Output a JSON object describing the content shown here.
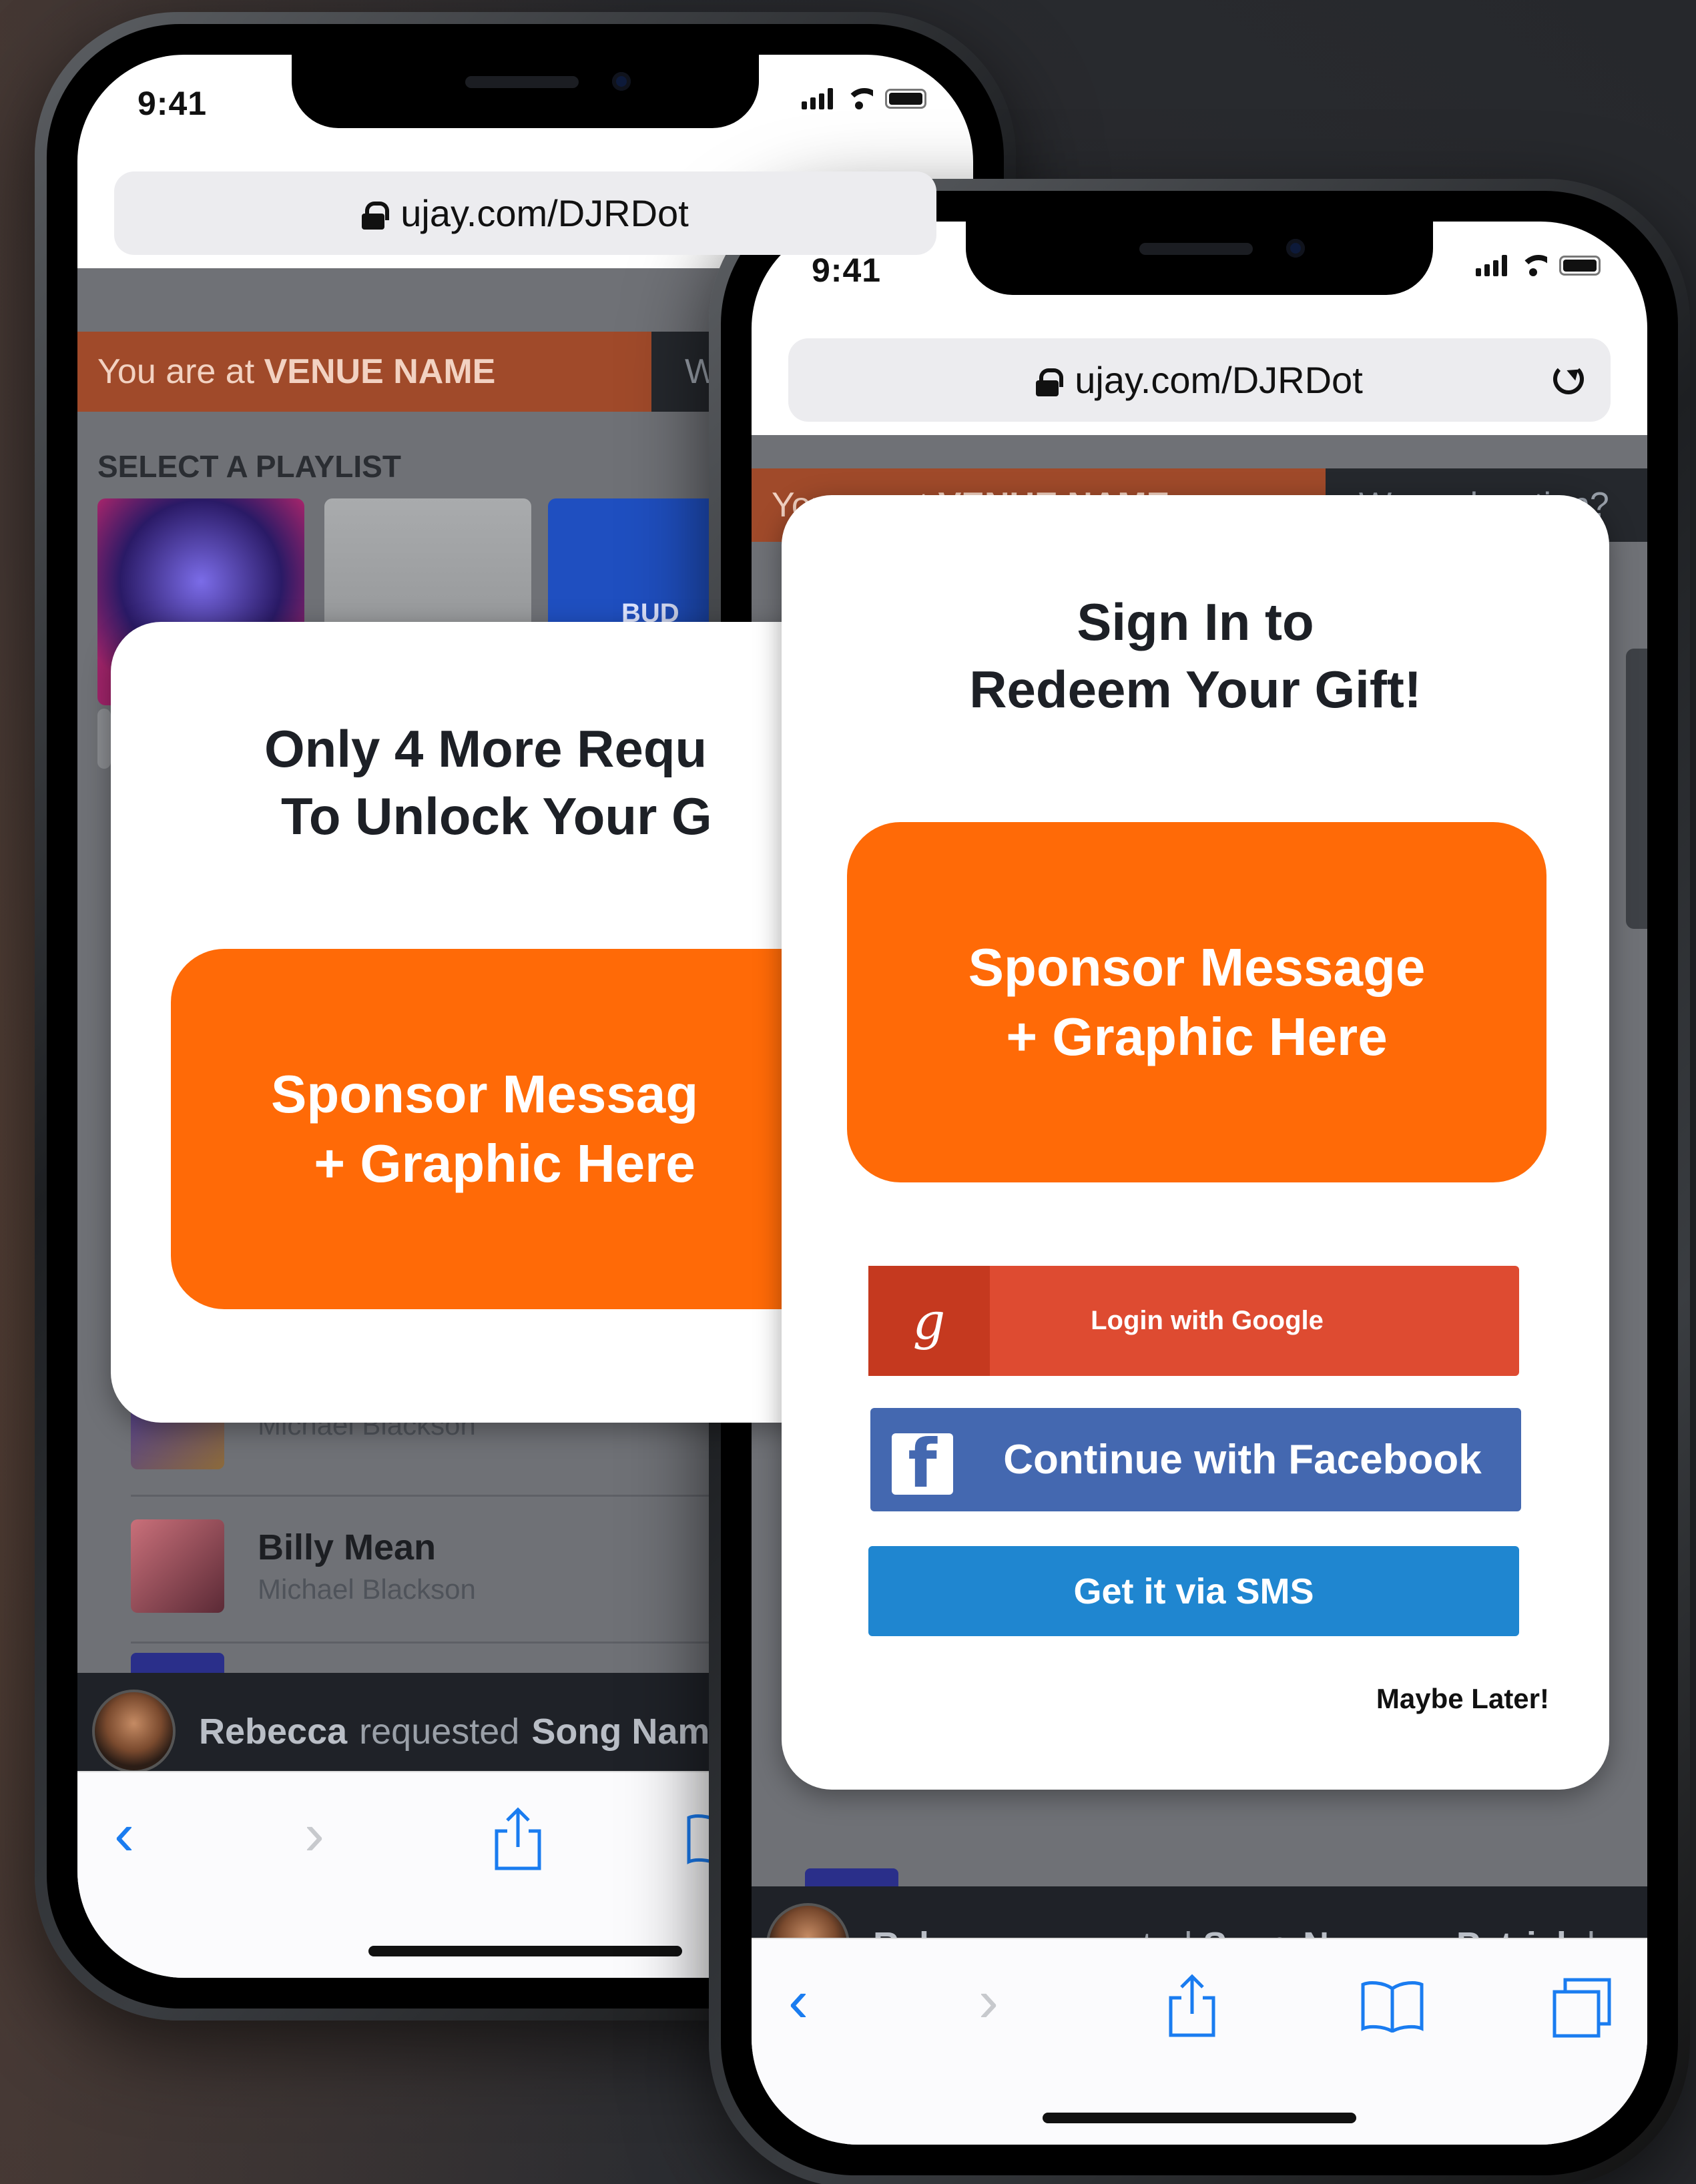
{
  "status": {
    "time": "9:41"
  },
  "browser": {
    "url": "ujay.com/DJRDot"
  },
  "venue": {
    "prefix": "You are at",
    "name": "VENUE NAME",
    "wrong_location": "Wrong location?"
  },
  "playlist": {
    "label": "SELECT A PLAYLIST",
    "bud_label": "BUD"
  },
  "songs": [
    {
      "title": "",
      "artist": "Michael Blackson"
    },
    {
      "title": "Billy Mean",
      "artist": "Michael Blackson"
    }
  ],
  "ticker": {
    "user1": "Rebecca",
    "verb1": "requested",
    "song1": "Song Name",
    "separator": "•",
    "user2": "Patrick",
    "verb2": "bou"
  },
  "left_modal": {
    "line1": "Only 4 More Requ",
    "line2": "To Unlock Your G",
    "sponsor_line1": "Sponsor Messag",
    "sponsor_line2": "+ Graphic Here"
  },
  "right_modal": {
    "line1": "Sign In to",
    "line2": "Redeem Your Gift!",
    "sponsor_line1": "Sponsor Message",
    "sponsor_line2": "+ Graphic Here",
    "google_label": "Login with Google",
    "facebook_label": "Continue with Facebook",
    "sms_label": "Get it via SMS",
    "later_label": "Maybe Later!"
  },
  "toolbar": {
    "back_icon": "back-icon",
    "forward_icon": "forward-icon",
    "share_icon": "share-icon",
    "bookmarks_icon": "bookmarks-icon",
    "tabs_icon": "tabs-icon"
  },
  "colors": {
    "accent_orange": "#ff6a07",
    "venue_bar": "#a04a2a",
    "google": "#de4b31",
    "facebook": "#4468b0",
    "sms": "#1f86d0",
    "ios_blue": "#1a7cf0"
  }
}
